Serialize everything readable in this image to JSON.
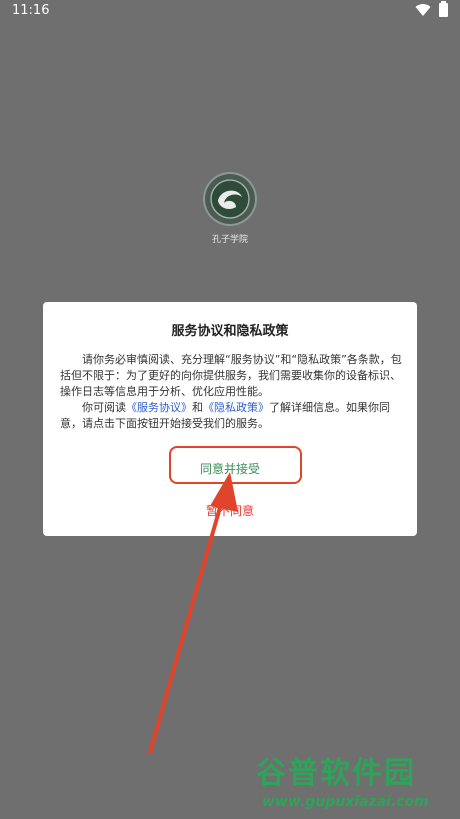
{
  "status_bar": {
    "time": "11:16"
  },
  "app": {
    "name": "孔子学院"
  },
  "dialog": {
    "title": "服务协议和隐私政策",
    "para1": "请你务必审慎阅读、充分理解“服务协议”和“隐私政策”各条款，包括但不限于：为了更好的向你提供服务，我们需要收集你的设备标识、操作日志等信息用于分析、优化应用性能。",
    "para2_prefix": "你可阅读",
    "link_service": "《服务协议》",
    "para2_and": "和",
    "link_privacy": "《隐私政策》",
    "para2_suffix": "了解详细信息。如果你同意，请点击下面按钮开始接受我们的服务。",
    "agree_label": "同意并接受",
    "disagree_label": "暂不同意"
  },
  "watermark": {
    "text": "谷普软件园",
    "url": "www.gupuxiazai.com"
  },
  "colors": {
    "agree": "#3a8f55",
    "disagree": "#e53935",
    "link": "#2f5fd0",
    "annotation": "#e0442a"
  }
}
